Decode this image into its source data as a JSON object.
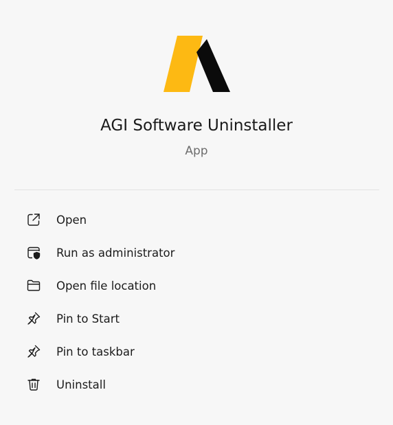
{
  "app": {
    "name": "AGI Software Uninstaller",
    "type": "App",
    "logo_icon": "agi-logo",
    "brand_colors": {
      "yellow": "#fdb913",
      "black": "#0b0b0b"
    }
  },
  "menu": {
    "items": [
      {
        "label": "Open",
        "icon": "open-external-icon"
      },
      {
        "label": "Run as administrator",
        "icon": "shield-admin-icon"
      },
      {
        "label": "Open file location",
        "icon": "folder-icon"
      },
      {
        "label": "Pin to Start",
        "icon": "pin-icon"
      },
      {
        "label": "Pin to taskbar",
        "icon": "pin-icon"
      },
      {
        "label": "Uninstall",
        "icon": "trash-icon"
      }
    ]
  }
}
